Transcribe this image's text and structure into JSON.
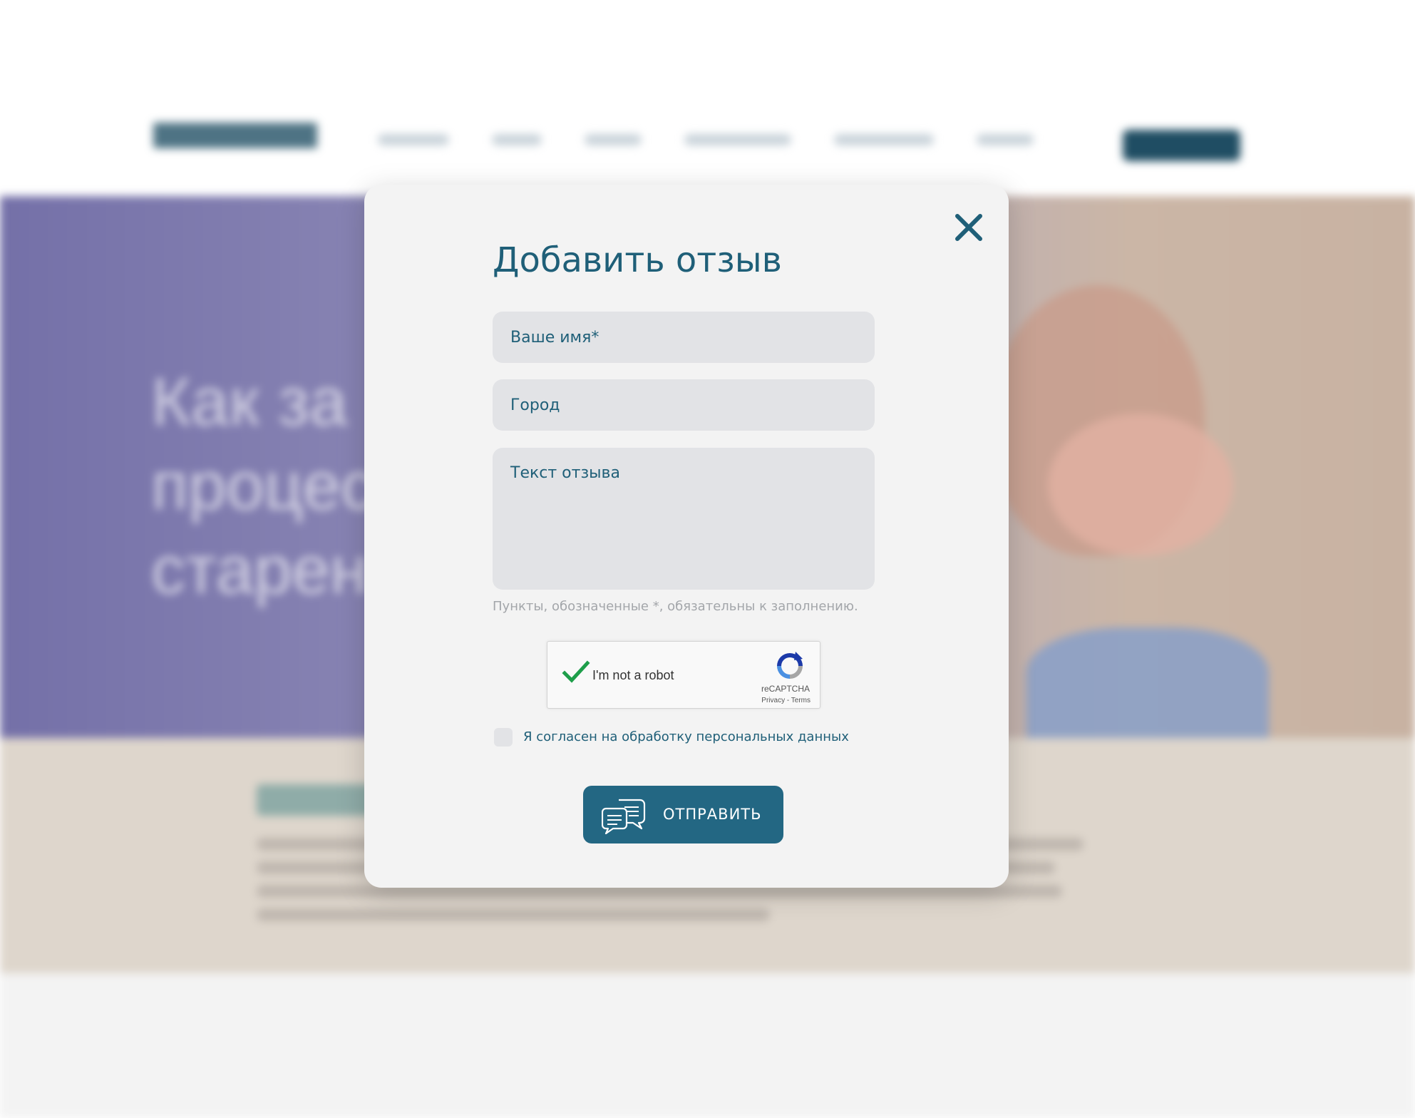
{
  "background": {
    "hero_title": "Как за\nпроцес\nстарен"
  },
  "modal": {
    "title": "Добавить отзыв",
    "name_placeholder": "Ваше имя*",
    "city_placeholder": "Город",
    "review_placeholder": "Текст отзыва",
    "required_hint": "Пункты, обозначенные *, обязательны к заполнению.",
    "captcha": {
      "label": "I'm not a robot",
      "brand": "reCAPTCHA",
      "links": "Privacy - Terms",
      "checked": true
    },
    "consent_label": "Я согласен на обработку персональных данных",
    "consent_checked": false,
    "submit_label": "ОТПРАВИТЬ"
  },
  "icons": {
    "close": "close-icon",
    "captcha_check": "checkmark-icon",
    "captcha_logo": "recaptcha-logo-icon",
    "submit": "chat-bubbles-icon"
  },
  "colors": {
    "accent": "#1f5f78",
    "button": "#236783",
    "field_bg": "#e2e3e6",
    "modal_bg": "#f3f3f3",
    "hint": "#a3a6aa",
    "check_green": "#1e9e4a"
  }
}
